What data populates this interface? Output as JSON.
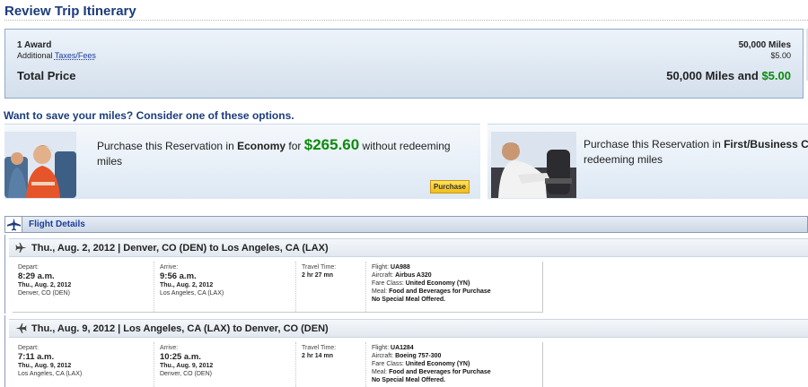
{
  "page": {
    "title": "Review Trip Itinerary"
  },
  "price_summary": {
    "award_label": "1 Award",
    "award_value": "50,000 Miles",
    "taxes_prefix": "Additional ",
    "taxes_link": "Taxes/Fees",
    "taxes_value": "$5.00",
    "total_label": "Total Price",
    "total_miles": "50,000 Miles",
    "total_and": " and ",
    "total_cash": "$5.00"
  },
  "save_options": {
    "heading": "Want to save your miles? Consider one of these options.",
    "economy": {
      "prefix": "Purchase this Reservation in ",
      "cabin": "Economy",
      "for_text": " for ",
      "price": "$265.60",
      "suffix": " without redeeming miles",
      "button_label": "Purchase"
    },
    "first": {
      "prefix": "Purchase this Reservation in ",
      "cabin": "First/Business C",
      "line2": "redeeming miles"
    }
  },
  "flight_details": {
    "header": "Flight Details",
    "segments": [
      {
        "title": "Thu., Aug. 2, 2012 | Denver, CO (DEN) to Los Angeles, CA (LAX)",
        "depart_label": "Depart:",
        "depart_time": "8:29 a.m.",
        "depart_date": "Thu., Aug. 2, 2012",
        "depart_city": "Denver, CO (DEN)",
        "arrive_label": "Arrive:",
        "arrive_time": "9:56 a.m.",
        "arrive_date": "Thu., Aug. 2, 2012",
        "arrive_city": "Los Angeles, CA (LAX)",
        "travel_label": "Travel Time:",
        "travel_time": "2 hr 27 mn",
        "flight_label": "Flight: ",
        "flight_no": "UA988",
        "aircraft_label": "Aircraft: ",
        "aircraft": "Airbus A320",
        "fare_label": "Fare Class: ",
        "fare": "United Economy (YN)",
        "meal_label": "Meal: ",
        "meal": "Food and Beverages for Purchase",
        "special_meal": "No Special Meal Offered."
      },
      {
        "title": "Thu., Aug. 9, 2012 | Los Angeles, CA (LAX) to Denver, CO (DEN)",
        "depart_label": "Depart:",
        "depart_time": "7:11 a.m.",
        "depart_date": "Thu., Aug. 9, 2012",
        "depart_city": "Los Angeles, CA (LAX)",
        "arrive_label": "Arrive:",
        "arrive_time": "10:25 a.m.",
        "arrive_date": "Thu., Aug. 9, 2012",
        "arrive_city": "Denver, CO (DEN)",
        "travel_label": "Travel Time:",
        "travel_time": "2 hr 14 mn",
        "flight_label": "Flight: ",
        "flight_no": "UA1284",
        "aircraft_label": "Aircraft: ",
        "aircraft": "Boeing 757-300",
        "fare_label": "Fare Class: ",
        "fare": "United Economy (YN)",
        "meal_label": "Meal: ",
        "meal": "Food and Beverages for Purchase",
        "special_meal": "No Special Meal Offered."
      }
    ]
  },
  "icons": {
    "flight_header": "airplane-icon",
    "depart": "airplane-takeoff-icon",
    "return": "airplane-return-icon"
  },
  "colors": {
    "heading_blue": "#1b3c7c",
    "link_blue": "#1b3c9c",
    "price_green": "#0d8a0d",
    "button_yellow": "#f3bd17"
  }
}
